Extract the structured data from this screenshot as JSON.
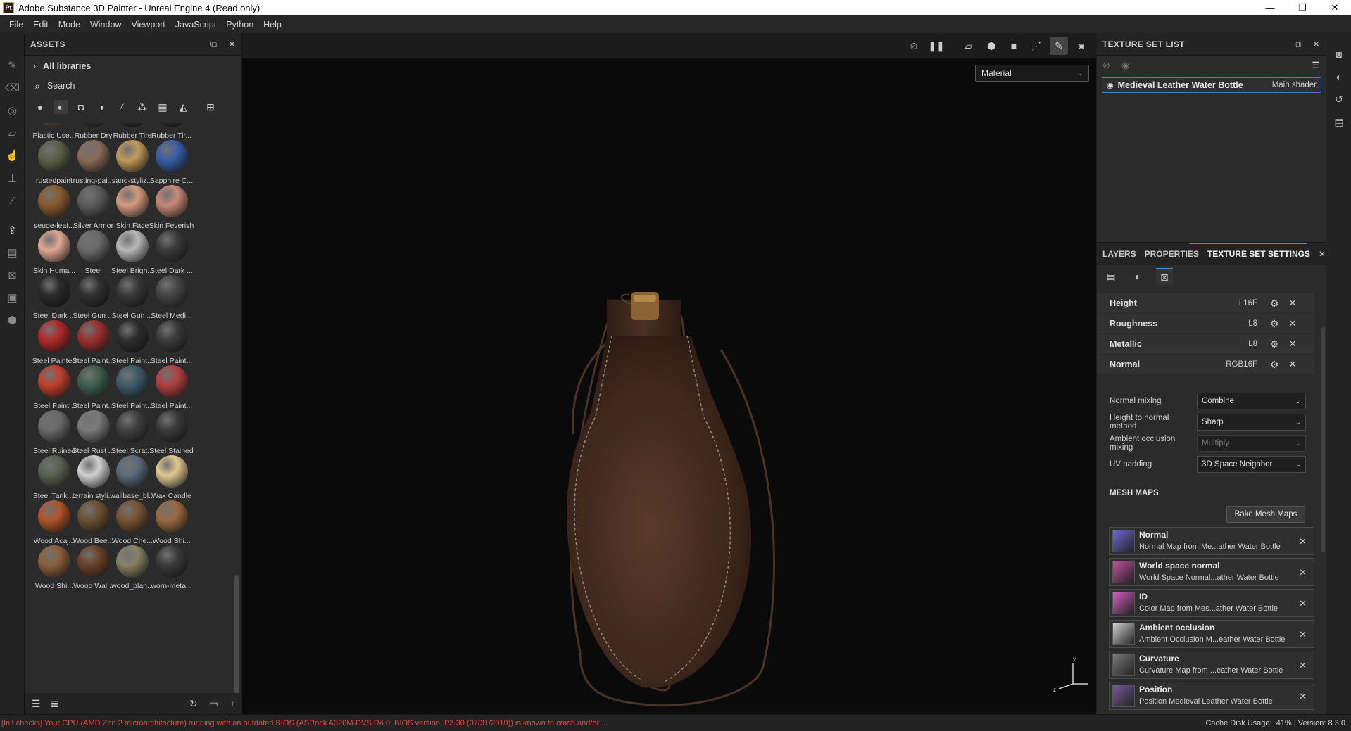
{
  "window": {
    "title": "Adobe Substance 3D Painter - Unreal Engine 4 (Read only)",
    "app_icon": "Pt",
    "controls": [
      "—",
      "❐",
      "✕"
    ]
  },
  "menu": [
    "File",
    "Edit",
    "Mode",
    "Window",
    "Viewport",
    "JavaScript",
    "Python",
    "Help"
  ],
  "left_tools": [
    "paint-brush-icon",
    "eraser-icon",
    "projection-icon",
    "polygon-fill-icon",
    "smudge-icon",
    "clone-stamp-icon",
    "color-picker-icon",
    "export-icon",
    "bake-icon",
    "geometry-mask-icon",
    "shelf-icon",
    "cube-icon"
  ],
  "assets": {
    "title": "ASSETS",
    "libraries": "All libraries",
    "search_placeholder": "Search",
    "materials": [
      {
        "name": "Plastic Use...",
        "color": "#6b5440"
      },
      {
        "name": "Rubber Dry",
        "color": "#3a3a3a"
      },
      {
        "name": "Rubber Tire",
        "color": "#2e2e2e"
      },
      {
        "name": "Rubber Tir...",
        "color": "#333333"
      },
      {
        "name": "rustedpaint",
        "color": "#5d6046"
      },
      {
        "name": "rusting-pai...",
        "color": "#8a6b58"
      },
      {
        "name": "sand-styliz...",
        "color": "#c29a5a"
      },
      {
        "name": "Sapphire C...",
        "color": "#3a5ea8"
      },
      {
        "name": "seude-leat...",
        "color": "#8a5a2e"
      },
      {
        "name": "Silver Armor",
        "color": "#5c5c5c"
      },
      {
        "name": "Skin Face",
        "color": "#d49a7e"
      },
      {
        "name": "Skin Feverish",
        "color": "#c88878"
      },
      {
        "name": "Skin Huma...",
        "color": "#e0a892"
      },
      {
        "name": "Steel",
        "color": "#6a6a6a"
      },
      {
        "name": "Steel Brigh...",
        "color": "#b8b8b8"
      },
      {
        "name": "Steel Dark ...",
        "color": "#3a3a3a"
      },
      {
        "name": "Steel Dark ...",
        "color": "#2a2a2a"
      },
      {
        "name": "Steel Gun ...",
        "color": "#303030"
      },
      {
        "name": "Steel Gun ...",
        "color": "#383838"
      },
      {
        "name": "Steel Medi...",
        "color": "#454545"
      },
      {
        "name": "Steel Painted",
        "color": "#b02a2a"
      },
      {
        "name": "Steel Paint...",
        "color": "#9a3030"
      },
      {
        "name": "Steel Paint...",
        "color": "#2e2e2e"
      },
      {
        "name": "Steel Paint...",
        "color": "#3a3a3a"
      },
      {
        "name": "Steel Paint...",
        "color": "#c0402e"
      },
      {
        "name": "Steel Paint...",
        "color": "#3e5e4e"
      },
      {
        "name": "Steel Paint...",
        "color": "#3e5a6a"
      },
      {
        "name": "Steel Paint...",
        "color": "#b04040"
      },
      {
        "name": "Steel Ruined",
        "color": "#6a6a6a"
      },
      {
        "name": "Steel Rust ...",
        "color": "#7a7a7a"
      },
      {
        "name": "Steel Scrat...",
        "color": "#404040"
      },
      {
        "name": "Steel Stained",
        "color": "#3a3a3a"
      },
      {
        "name": "Steel Tank ...",
        "color": "#5a6050"
      },
      {
        "name": "terrain styli...",
        "color": "#d0d0d0"
      },
      {
        "name": "wallbase_bl...",
        "color": "#5a6a7a"
      },
      {
        "name": "Wax Candle",
        "color": "#e0c890"
      },
      {
        "name": "Wood Acaj...",
        "color": "#b0542a"
      },
      {
        "name": "Wood Bee...",
        "color": "#6a5030"
      },
      {
        "name": "Wood Che...",
        "color": "#7a5234"
      },
      {
        "name": "Wood Shi...",
        "color": "#9a6a3e"
      },
      {
        "name": "Wood Shi...",
        "color": "#8a603a"
      },
      {
        "name": "Wood Wal...",
        "color": "#6a4028"
      },
      {
        "name": "wood_plan...",
        "color": "#8a8064"
      },
      {
        "name": "worn-meta...",
        "color": "#3a3a3a"
      }
    ]
  },
  "viewport": {
    "material_mode": "Material"
  },
  "texture_set_list": {
    "title": "TEXTURE SET LIST",
    "set_name": "Medieval Leather Water Bottle",
    "shader": "Main shader"
  },
  "texture_set_settings": {
    "tabs": [
      "LAYERS",
      "PROPERTIES",
      "TEXTURE SET SETTINGS"
    ],
    "channels": [
      {
        "name": "Height",
        "format": "L16F"
      },
      {
        "name": "Roughness",
        "format": "L8"
      },
      {
        "name": "Metallic",
        "format": "L8"
      },
      {
        "name": "Normal",
        "format": "RGB16F"
      }
    ],
    "options": [
      {
        "label": "Normal mixing",
        "value": "Combine",
        "disabled": false
      },
      {
        "label": "Height to normal method",
        "value": "Sharp",
        "disabled": false
      },
      {
        "label": "Ambient occlusion mixing",
        "value": "Multiply",
        "disabled": true
      },
      {
        "label": "UV padding",
        "value": "3D Space Neighbor",
        "disabled": false
      }
    ],
    "mesh_maps_title": "MESH MAPS",
    "bake_button": "Bake Mesh Maps",
    "mesh_maps": [
      {
        "name": "Normal",
        "source": "Normal Map from Me...ather Water Bottle",
        "thumb": "#6a6ad8"
      },
      {
        "name": "World space normal",
        "source": "World Space Normal...ather Water Bottle",
        "thumb": "#c050a0"
      },
      {
        "name": "ID",
        "source": "Color Map from Mes...ather Water Bottle",
        "thumb": "#d060c0"
      },
      {
        "name": "Ambient occlusion",
        "source": "Ambient Occlusion M...eather Water Bottle",
        "thumb": "#cfcfcf"
      },
      {
        "name": "Curvature",
        "source": "Curvature Map from ...eather Water Bottle",
        "thumb": "#7a7a7a"
      },
      {
        "name": "Position",
        "source": "Position Medieval Leather Water Bottle",
        "thumb": "#7a5a9a"
      }
    ]
  },
  "status": {
    "warning": "[Init checks] Your CPU (AMD Zen 2 microarchitecture) running with an outdated BIOS (ASRock A320M-DVS R4.0, BIOS version: P3.30 (07/31/2019)) is known to crash and/or ...",
    "cache": "Cache Disk Usage:",
    "cache_value": "41%",
    "version": "| Version: 8.3.0"
  }
}
